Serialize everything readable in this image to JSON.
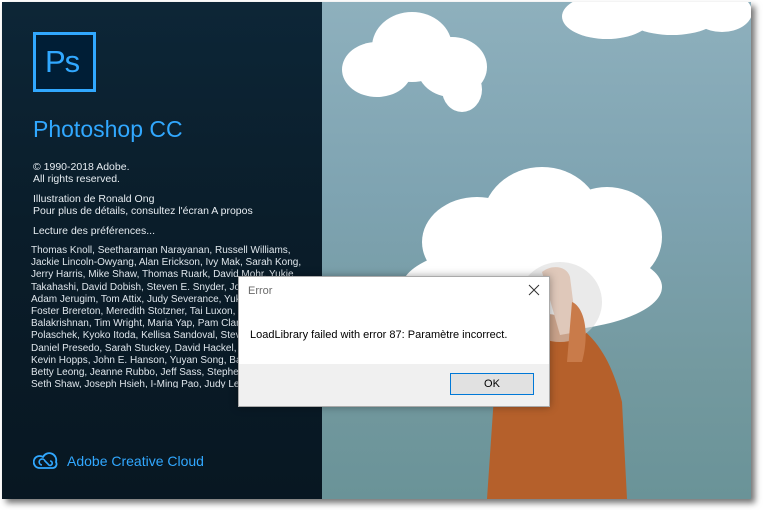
{
  "splash": {
    "logo_text": "Ps",
    "product_name": "Photoshop CC",
    "copyright_line1": "© 1990-2018 Adobe.",
    "copyright_line2": "All rights reserved.",
    "illustration_line1": "Illustration de Ronald Ong",
    "illustration_line2": "Pour plus de détails, consultez l'écran A propos",
    "status": "Lecture des préférences...",
    "credits": [
      "Thomas Knoll, Seetharaman Narayanan, Russell Williams,",
      "Jackie Lincoln-Owyang, Alan Erickson, Ivy Mak, Sarah Kong,",
      "Jerry Harris, Mike Shaw, Thomas Ruark, David Mohr, Yukie",
      "Takahashi, David Dobish, Steven E. Snyder, John",
      "Adam Jerugim, Tom Attix, Judy Severance, Yuko",
      "Foster Brereton, Meredith Stotzner, Tai Luxon, Vin",
      "Balakrishnan, Tim Wright, Maria Yap, Pam Clark,",
      "Polaschek, Kyoko Itoda, Kellisa Sandoval, Steve",
      "Daniel Presedo, Sarah Stuckey, David Hackel, Er",
      "Kevin Hopps, John E. Hanson, Yuyan Song, Bark",
      "Betty Leong, Jeanne Rubbo, Jeff Sass, Stephen N",
      "Seth Shaw, Joseph Hsieh, I-Ming Pao, Judy Lee,"
    ],
    "cc_label": "Adobe Creative Cloud",
    "accent_color": "#31a8ff"
  },
  "dialog": {
    "title": "Error",
    "message": "LoadLibrary failed with error 87: Paramètre incorrect.",
    "ok_label": "OK"
  }
}
